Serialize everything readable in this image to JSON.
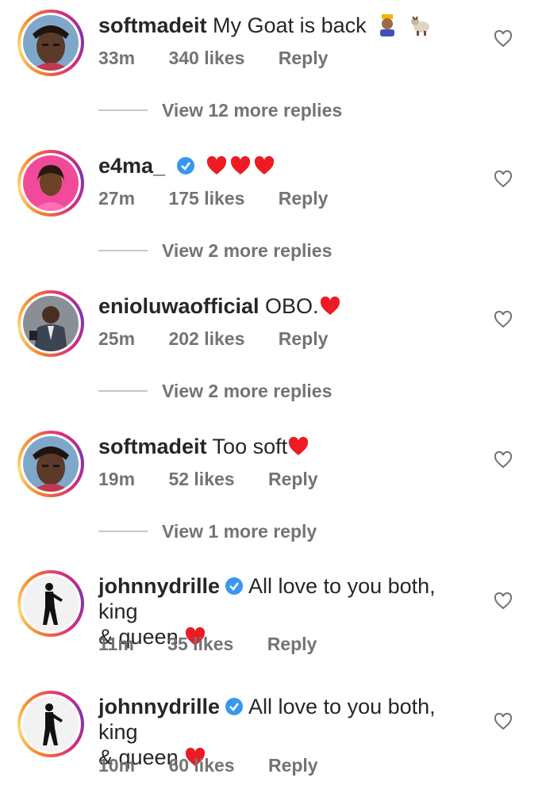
{
  "comments": [
    {
      "username": "softmadeit",
      "text": "My Goat is back",
      "time": "33m",
      "likes": "340 likes",
      "reply": "Reply",
      "view_replies": "View 12 more replies",
      "emoji": "prince-goat"
    },
    {
      "username": "e4ma_",
      "text": "",
      "time": "27m",
      "likes": "175 likes",
      "reply": "Reply",
      "view_replies": "View 2 more replies",
      "emoji": "three-hearts"
    },
    {
      "username": "enioluwaofficial",
      "text": "OBO.",
      "time": "25m",
      "likes": "202 likes",
      "reply": "Reply",
      "view_replies": "View 2 more replies",
      "emoji": "heart"
    },
    {
      "username": "softmadeit",
      "text": "Too soft",
      "time": "19m",
      "likes": "52 likes",
      "reply": "Reply",
      "view_replies": "View 1 more reply",
      "emoji": "heart"
    },
    {
      "username": "johnnydrille",
      "text_line1": "All love to you both, king",
      "text_line2": "& queen",
      "time": "11m",
      "likes": "35 likes",
      "reply": "Reply",
      "emoji": "heart"
    },
    {
      "username": "johnnydrille",
      "text_line1": "All love to you both, king",
      "text_line2": "& queen",
      "time": "10m",
      "likes": "60 likes",
      "reply": "Reply",
      "emoji": "heart"
    }
  ],
  "colors": {
    "text": "#262626",
    "meta": "#737373",
    "verified": "#3897f0",
    "heart": "#ed1c24",
    "ring_start": "#f58529",
    "ring_end": "#8134af"
  },
  "icons": [
    "like-heart-outline-icon",
    "verified-badge-icon",
    "red-heart-emoji"
  ]
}
